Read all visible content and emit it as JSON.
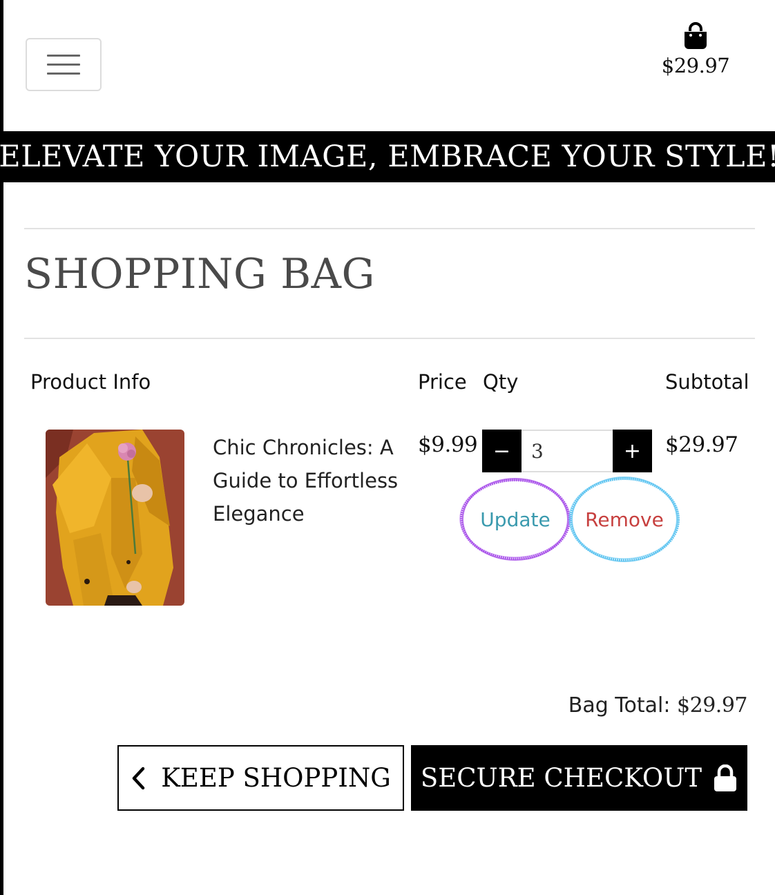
{
  "header": {
    "menu_toggle_icon": "hamburger-menu-icon",
    "bag_icon": "shopping-bag-icon",
    "bag_total": "$29.97"
  },
  "banner": {
    "text": "ELEVATE YOUR IMAGE, EMBRACE YOUR STYLE!"
  },
  "page": {
    "title": "SHOPPING BAG"
  },
  "table": {
    "headers": {
      "product_info": "Product Info",
      "price": "Price",
      "qty": "Qty",
      "subtotal": "Subtotal"
    },
    "items": [
      {
        "name": "Chic Chronicles: A Guide to Effortless Elegance",
        "price": "$9.99",
        "quantity": "3",
        "subtotal": "$29.97",
        "image_icon": "product-photo-yellow-coat-with-flower"
      }
    ],
    "qty_decrement_label": "−",
    "qty_increment_label": "+",
    "update_label": "Update",
    "remove_label": "Remove"
  },
  "footer": {
    "bag_total_label": "Bag Total:",
    "bag_total_value": "$29.97",
    "keep_shopping_label": "KEEP SHOPPING",
    "secure_checkout_label": "SECURE CHECKOUT",
    "keep_shopping_icon": "chevron-left-icon",
    "secure_checkout_icon": "lock-icon"
  },
  "colors": {
    "update_link": "#3a9aae",
    "remove_link": "#c7403f",
    "update_annotation": "#a64ee8",
    "remove_annotation": "#5cc3f0",
    "banner_bg": "#000000",
    "title_text": "#4a4a4a"
  }
}
